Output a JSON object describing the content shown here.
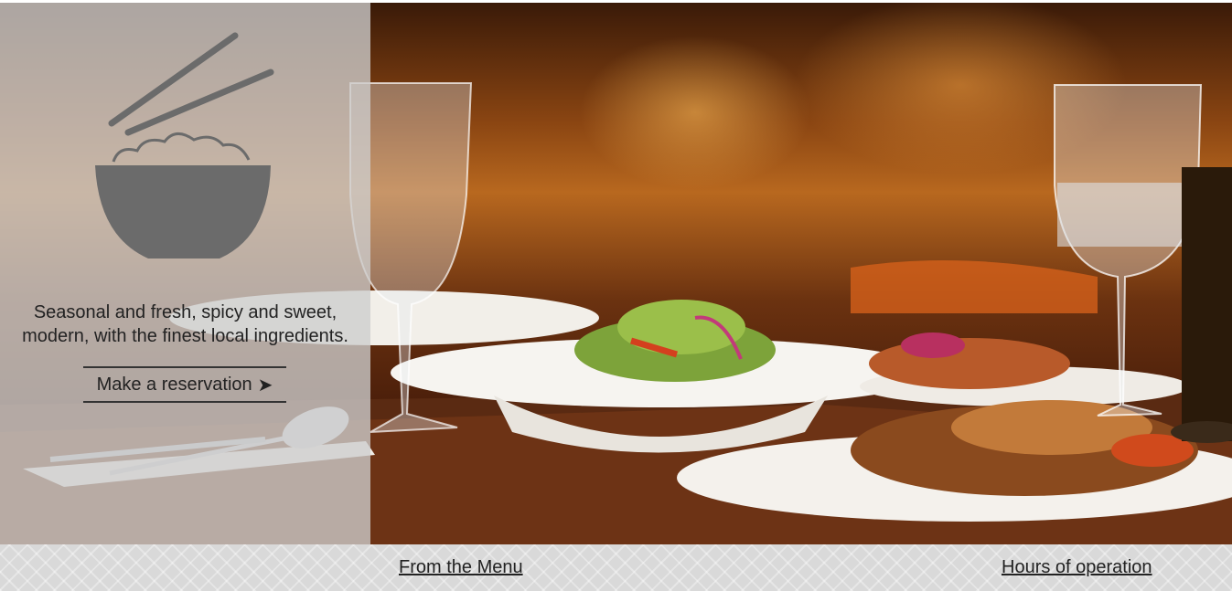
{
  "hero": {
    "background_image": "restaurant-table-photo",
    "overlay_color": "#cdcdcd"
  },
  "panel": {
    "logo_icon": "rice-bowl-chopsticks-icon",
    "tagline_line1": "Seasonal and fresh, spicy and sweet,",
    "tagline_line2": "modern, with the finest local ingredients.",
    "reservation_label": "Make a reservation",
    "reservation_arrow": "➤"
  },
  "footer": {
    "menu_link": "From the Menu",
    "hours_link": "Hours of operation"
  },
  "colors": {
    "text": "#222222",
    "footer_bg": "#d9d9d9",
    "logo": "#6b6b6b"
  }
}
